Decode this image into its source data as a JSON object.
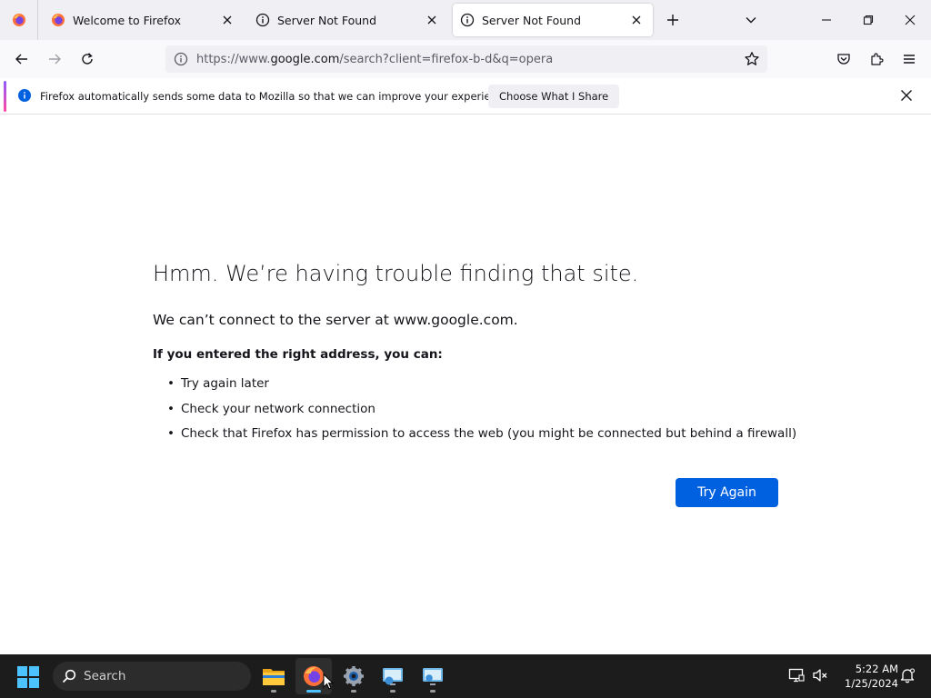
{
  "tabs": [
    {
      "title": "Welcome to Firefox",
      "icon": "firefox-icon",
      "active": false
    },
    {
      "title": "Server Not Found",
      "icon": "info-icon",
      "active": false
    },
    {
      "title": "Server Not Found",
      "icon": "info-icon",
      "active": true
    }
  ],
  "navbar": {
    "url_prefix": "https://www.",
    "url_host": "google.com",
    "url_rest": "/search?client=firefox-b-d&q=opera"
  },
  "notification": {
    "message": "Firefox automatically sends some data to Mozilla so that we can improve your experience.",
    "button": "Choose What I Share"
  },
  "error": {
    "title": "Hmm. We’re having trouble finding that site.",
    "subtitle": "We can’t connect to the server at www.google.com.",
    "list_heading": "If you entered the right address, you can:",
    "items": [
      "Try again later",
      "Check your network connection",
      "Check that Firefox has permission to access the web (you might be connected but behind a firewall)"
    ],
    "button": "Try Again"
  },
  "taskbar": {
    "search_placeholder": "Search",
    "apps": [
      "file-explorer-icon",
      "firefox-icon",
      "settings-icon",
      "remote-desktop-icon",
      "network-app-icon"
    ],
    "time": "5:22 AM",
    "date": "1/25/2024"
  },
  "colors": {
    "accent_blue": "#0061e0",
    "tabstrip_bg": "#f0f0f4",
    "taskbar_bg": "#1c1c1c",
    "notification_accent_start": "#9059ff",
    "notification_accent_end": "#ff4aa2"
  }
}
